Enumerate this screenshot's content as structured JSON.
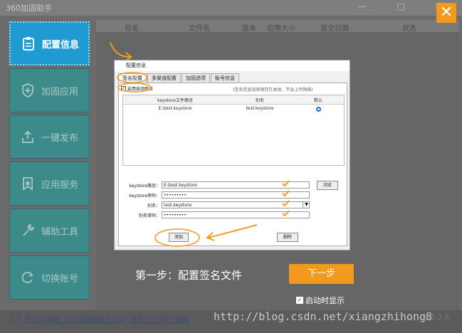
{
  "window": {
    "title": "360加固助手",
    "controls": "— □"
  },
  "sidebar": {
    "items": [
      {
        "label": "配置信息",
        "icon": "clipboard-icon",
        "active": true
      },
      {
        "label": "加固应用",
        "icon": "shield-plus-icon"
      },
      {
        "label": "一键发布",
        "icon": "upload-icon"
      },
      {
        "label": "应用服务",
        "icon": "star-badge-icon"
      },
      {
        "label": "辅助工具",
        "icon": "wrench-icon"
      },
      {
        "label": "切换账号",
        "icon": "refresh-icon"
      }
    ]
  },
  "table": {
    "headers": [
      "包名",
      "文件名",
      "版本",
      "应用大小",
      "提交日期",
      "状态"
    ]
  },
  "dialog": {
    "title": "配置信息",
    "tabs": [
      "签名配置",
      "多渠道配置",
      "加固选项",
      "账号信息"
    ],
    "enable_sign_label": "启用自动签名",
    "note": "(签名信息加密保存在本地，不会上传网络)",
    "ks_headers": [
      "keystore文件路径",
      "别名",
      "默认"
    ],
    "ks_rows": [
      {
        "path": "E:\\test.keystore",
        "alias": "test.keystore"
      }
    ],
    "form": {
      "path_label": "keystore路径：",
      "path_value": "E:\\test.keystore",
      "pwd_label": "keystore密码：",
      "pwd_value": "•••••••••",
      "alias_label": "别名：",
      "alias_value": "test.keystore",
      "alias_pwd_label": "别名密码：",
      "alias_pwd_value": "•••••••••"
    },
    "browse_label": "浏览",
    "add_label": "添加",
    "delete_label": "删除"
  },
  "step_text": "第一步：配置签名文件",
  "next_label": "下一步",
  "show_on_start_label": "启动时显示",
  "footer": {
    "text": "免SDK集成 360加固保推出应用“崩溃日志分析”服务",
    "version": "1.5.2.8"
  },
  "watermark": "http://blog.csdn.net/xiangzhihong8",
  "colors": {
    "accent": "#f39a1e",
    "active_nav": "#1f9bd2",
    "nav": "#3d8a8a"
  }
}
